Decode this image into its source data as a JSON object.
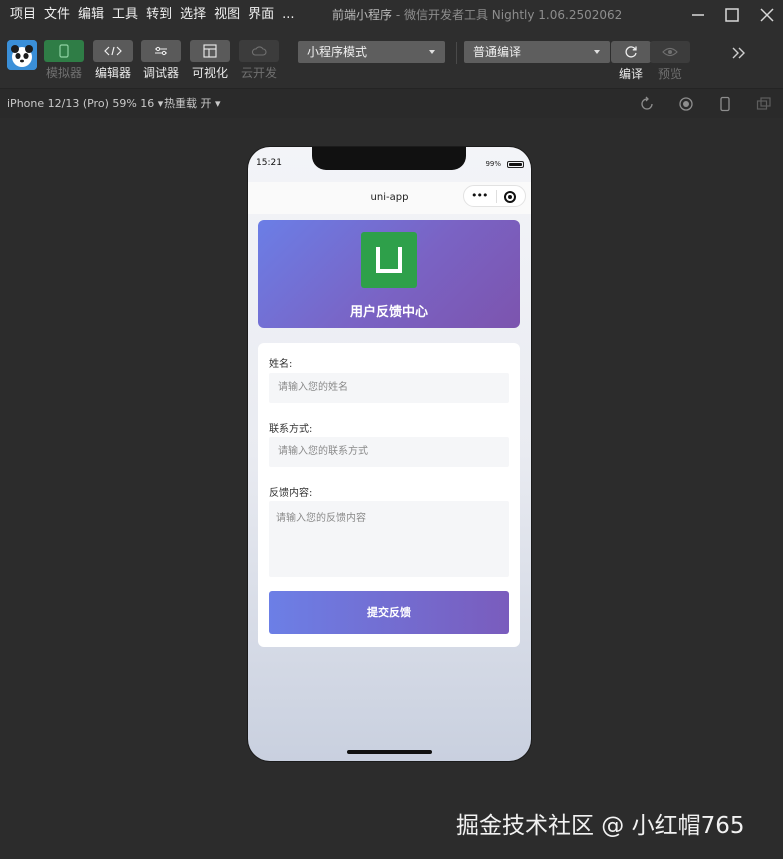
{
  "menu": [
    "项目",
    "文件",
    "编辑",
    "工具",
    "转到",
    "选择",
    "视图",
    "界面",
    "..."
  ],
  "window": {
    "title": "前端小程序",
    "subtitle": "- 微信开发者工具 Nightly 1.06.2502062"
  },
  "toolbar": {
    "simulator": "模拟器",
    "editor": "编辑器",
    "debugger": "调试器",
    "visual": "可视化",
    "cloud": "云开发",
    "mode_select": "小程序模式",
    "compile_select": "普通编译",
    "compile": "编译",
    "preview": "预览"
  },
  "devicebar": {
    "device": "iPhone 12/13 (Pro) 59% 16 ▾",
    "hotreload": "热重载 开 ▾"
  },
  "phone": {
    "time": "15:21",
    "battery": "99%",
    "nav_title": "uni-app",
    "capsule_dots": "•••"
  },
  "page": {
    "header_title": "用户反馈中心",
    "name_label": "姓名:",
    "name_placeholder": "请输入您的姓名",
    "contact_label": "联系方式:",
    "contact_placeholder": "请输入您的联系方式",
    "content_label": "反馈内容:",
    "content_placeholder": "请输入您的反馈内容",
    "submit_label": "提交反馈"
  },
  "watermark": "掘金技术社区 @ 小红帽765",
  "colors": {
    "accent_start": "#6b7ee6",
    "accent_end": "#7c54ae",
    "logo_green": "#2ea04a",
    "active_tool": "#2f7d46"
  }
}
